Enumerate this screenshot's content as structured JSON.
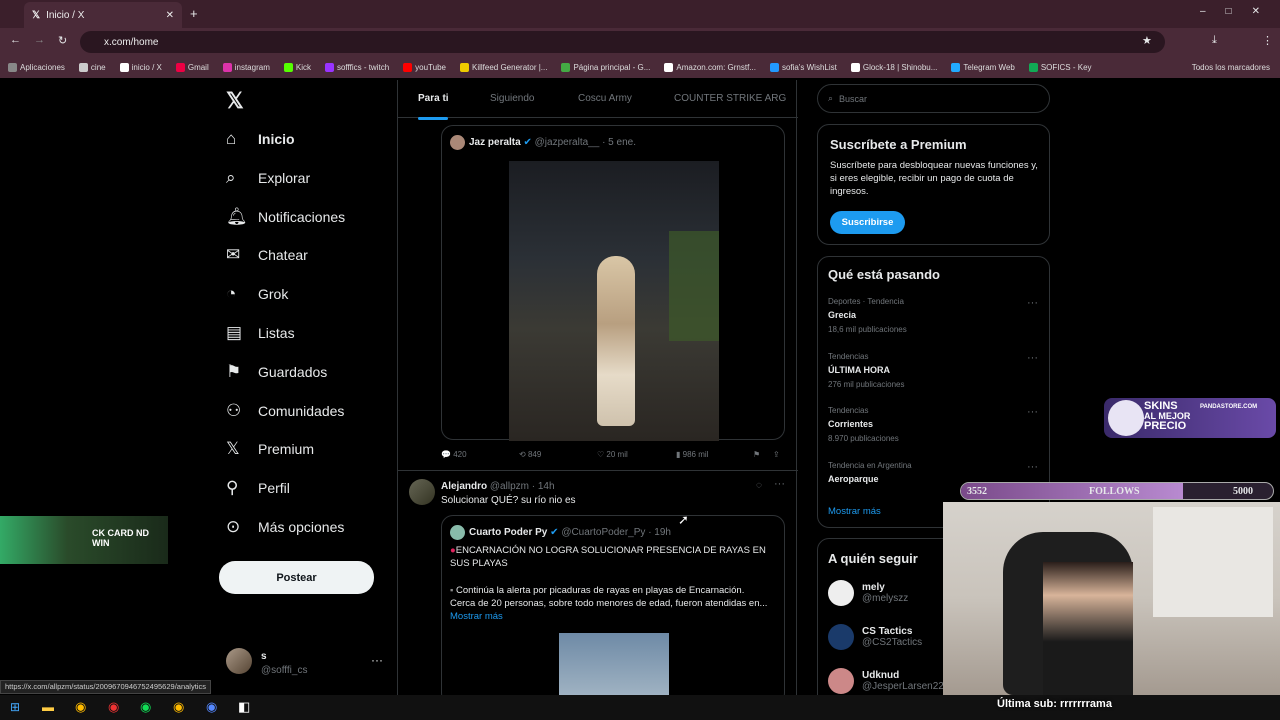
{
  "browser": {
    "tab_title": "Inicio / X",
    "url": "x.com/home",
    "status_url": "https://x.com/allpzm/status/2009670946752495629/analytics",
    "bookmarks": [
      {
        "label": "Aplicaciones",
        "color": "#888"
      },
      {
        "label": "cine",
        "color": "#ccc"
      },
      {
        "label": "inicio / X",
        "color": "#fff"
      },
      {
        "label": "Gmail",
        "color": "#e04"
      },
      {
        "label": "instagram",
        "color": "#d3a"
      },
      {
        "label": "Kick",
        "color": "#5f0"
      },
      {
        "label": "sofffics - twitch",
        "color": "#93f"
      },
      {
        "label": "youTube",
        "color": "#f00"
      },
      {
        "label": "Killfeed Generator |...",
        "color": "#ec0"
      },
      {
        "label": "Página principal - G...",
        "color": "#4a4"
      },
      {
        "label": "Amazon.com: Grnstf...",
        "color": "#fff"
      },
      {
        "label": "sofia's WishList",
        "color": "#29f"
      },
      {
        "label": "Glock-18 | Shinobu...",
        "color": "#fff"
      },
      {
        "label": "Telegram Web",
        "color": "#2af"
      },
      {
        "label": "SOFICS - Key",
        "color": "#1a5"
      }
    ],
    "bookmarks_folder": "Todos los marcadores"
  },
  "nav": {
    "items": [
      {
        "label": "Inicio",
        "icon": "home-icon"
      },
      {
        "label": "Explorar",
        "icon": "search-icon"
      },
      {
        "label": "Notificaciones",
        "icon": "bell-icon"
      },
      {
        "label": "Chatear",
        "icon": "mail-icon"
      },
      {
        "label": "Grok",
        "icon": "grok-icon"
      },
      {
        "label": "Listas",
        "icon": "list-icon"
      },
      {
        "label": "Guardados",
        "icon": "bookmark-icon"
      },
      {
        "label": "Comunidades",
        "icon": "people-icon"
      },
      {
        "label": "Premium",
        "icon": "x-logo-icon"
      },
      {
        "label": "Perfil",
        "icon": "person-icon"
      },
      {
        "label": "Más opciones",
        "icon": "more-circle-icon"
      }
    ],
    "post_button": "Postear",
    "user_name": "s",
    "user_handle": "@sofffi_cs"
  },
  "feed": {
    "tabs": [
      "Para ti",
      "Siguiendo",
      "Coscu Army",
      "COUNTER STRIKE ARG"
    ],
    "quoted1": {
      "name": "Jaz peralta",
      "handle": "@jazperalta__",
      "time": "· 5 ene."
    },
    "stats1": {
      "replies": "420",
      "retweets": "849",
      "likes": "20 mil",
      "views": "986 mil"
    },
    "post2": {
      "name": "Alejandro",
      "handle": "@allpzm",
      "time": "· 14h",
      "text": "Solucionar QUÉ? su río nio es"
    },
    "quoted2": {
      "name": "Cuarto Poder Py",
      "handle": "@CuartoPoder_Py",
      "time": "· 19h",
      "headline": "ENCARNACIÓN NO LOGRA SOLUCIONAR PRESENCIA DE RAYAS EN SUS PLAYAS",
      "body1": "Continúa la alerta por picaduras de rayas en playas de Encarnación.",
      "body2": "Cerca de 20 personas, sobre todo menores de edad, fueron atendidas en...",
      "more": "Mostrar más"
    }
  },
  "sidebar": {
    "search_placeholder": "Buscar",
    "premium": {
      "title": "Suscríbete a Premium",
      "text": "Suscríbete para desbloquear nuevas funciones y, si eres elegible, recibir un pago de cuota de ingresos.",
      "button": "Suscribirse"
    },
    "trends_title": "Qué está pasando",
    "trends": [
      {
        "context": "Deportes · Tendencia",
        "name": "Grecia",
        "count": "18,6 mil publicaciones"
      },
      {
        "context": "Tendencias",
        "name": "ÚLTIMA HORA",
        "count": "276 mil publicaciones"
      },
      {
        "context": "Tendencias",
        "name": "Corrientes",
        "count": "8.970 publicaciones"
      },
      {
        "context": "Tendencia en Argentina",
        "name": "Aeroparque",
        "count": ""
      }
    ],
    "show_more": "Mostrar más",
    "follow_title": "A quién seguir",
    "follow": [
      {
        "name": "mely",
        "handle": "@melyszz"
      },
      {
        "name": "CS Tactics",
        "handle": "@CS2Tactics"
      },
      {
        "name": "Udknud",
        "handle": "@JesperLarsen222"
      }
    ]
  },
  "overlay": {
    "follows_current": "3552",
    "follows_label": "FOLLOWS",
    "follows_goal": "5000",
    "follows_progress": 0.71,
    "ad_line1": "SKINS",
    "ad_line2": "AL MEJOR",
    "ad_line3": "PRECIO",
    "ad_site": "PANDASTORE.COM",
    "left_banner": "CK CARD ND WIN",
    "sub_text": "Última sub: rrrrrrrama"
  }
}
